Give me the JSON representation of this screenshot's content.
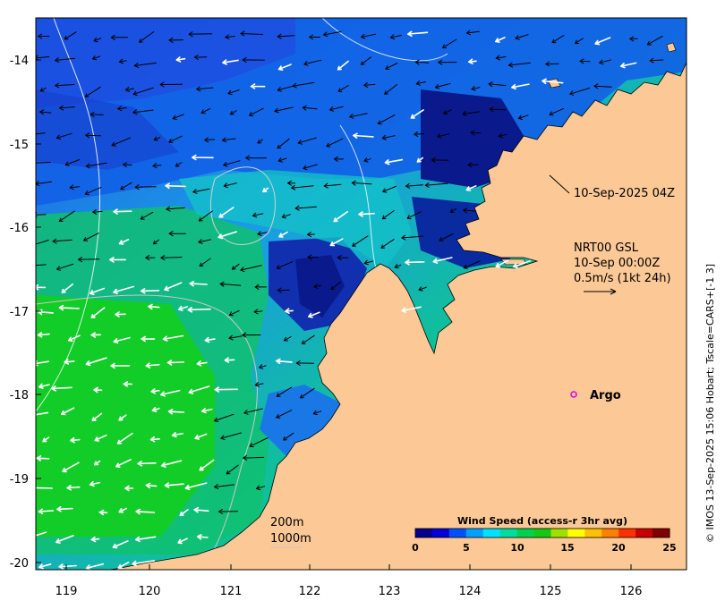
{
  "map": {
    "x_ticks": [
      "119",
      "120",
      "121",
      "122",
      "123",
      "124",
      "125",
      "126"
    ],
    "y_ticks": [
      "-14",
      "-15",
      "-16",
      "-17",
      "-18",
      "-19",
      "-20"
    ],
    "colors": {
      "land": "#fbc896",
      "deep_blue": "#0a1a8c",
      "blue": "#1a5ae0",
      "sky": "#1fb4ee",
      "cyan": "#00c8c8",
      "green": "#00c846",
      "bright_green": "#14d21e"
    }
  },
  "annotations": {
    "timestamp": "10-Sep-2025 04Z",
    "product": "NRT00 GSL",
    "product_time": "10-Sep 00:00Z",
    "scale_text": "0.5m/s (1kt 24h)",
    "argo_label": "Argo",
    "contour_200": "200m",
    "contour_1000": "1000m"
  },
  "colorbar": {
    "title": "Wind Speed (access-r 3hr avg)",
    "ticks": [
      "0",
      "5",
      "10",
      "15",
      "20",
      "25"
    ],
    "colors": [
      "#00008c",
      "#0000d8",
      "#0050ff",
      "#00a0ff",
      "#00e0ff",
      "#00dca0",
      "#00d250",
      "#14c814",
      "#a0e000",
      "#ffff00",
      "#ffc000",
      "#ff8000",
      "#ff3000",
      "#c80000",
      "#800000"
    ]
  },
  "credit": "© IMOS 13-Sep-2025 15:06 Hobart; Tscale=CARS+[-1 3]"
}
